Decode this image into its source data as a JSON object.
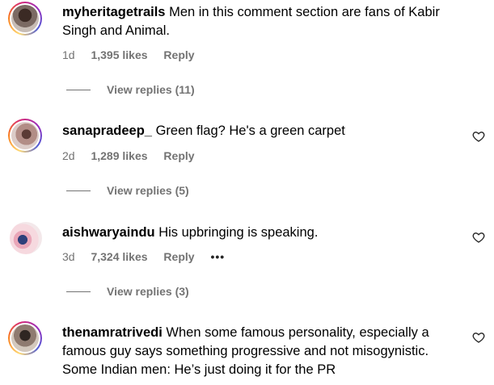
{
  "comments": [
    {
      "username": "myheritagetrails",
      "text_line1": "Men in this comment section are fans of Kabir",
      "text_line2": "Singh and Animal.",
      "age": "1d",
      "likes": "1,395 likes",
      "reply": "Reply",
      "view_replies": "View replies (11)",
      "avatar_icon": "profile-photo"
    },
    {
      "username": "sanapradeep_",
      "text_line1": "Green flag? He's a green carpet",
      "age": "2d",
      "likes": "1,289 likes",
      "reply": "Reply",
      "view_replies": "View replies (5)",
      "avatar_icon": "profile-photo"
    },
    {
      "username": "aishwaryaindu",
      "text_line1": "His upbringing is speaking.",
      "age": "3d",
      "likes": "7,324 likes",
      "reply": "Reply",
      "more": "•••",
      "view_replies": "View replies (3)",
      "avatar_icon": "profile-photo"
    },
    {
      "username": "thenamratrivedi",
      "text_line1": "When some famous personality, especially a",
      "text_line2": "famous guy says something progressive and not misogynistic.",
      "text_line3": "Some Indian men: He’s just doing it for the PR",
      "avatar_icon": "profile-photo"
    }
  ],
  "icons": {
    "like": "heart-outline-icon",
    "more": "more-options-icon"
  },
  "colors": {
    "text": "#000000",
    "secondary": "#737373",
    "background": "#ffffff",
    "story_ring": [
      "#feda75",
      "#fa7e1e",
      "#d62976",
      "#962fbf",
      "#4f5bd5"
    ]
  }
}
